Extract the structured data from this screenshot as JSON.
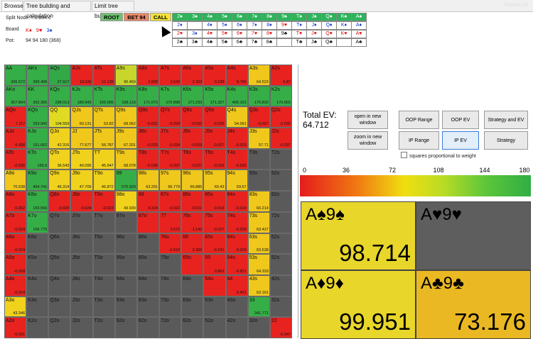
{
  "tabs": [
    "Browser",
    "Tree building and calculation",
    "Limit tree building"
  ],
  "watermark": "Flowsicalr",
  "info": {
    "split_node_label": "Split Node:",
    "split_node_value": "r:0:b94:c",
    "board_label": "Board",
    "board_cards": [
      {
        "t": "K♦",
        "c": "red"
      },
      {
        "t": "9♥",
        "c": "red"
      },
      {
        "t": "3♠",
        "c": "blue"
      }
    ],
    "pot_label": "Pot:",
    "pot_value": "94 94 180 (368)"
  },
  "node_buttons": [
    {
      "label": "ROOT",
      "bg": "#6fc06f"
    },
    {
      "label": "BET 94",
      "bg": "#e88a6a"
    },
    {
      "label": "CALL",
      "bg": "#f2e23a"
    }
  ],
  "card_columns": [
    [
      "2♠",
      "2♦",
      "2♥",
      "2♣"
    ],
    [
      "3♠",
      "",
      "3♦",
      "3♣"
    ],
    [
      "4♠",
      "4♦",
      "4♥",
      "4♣"
    ],
    [
      "5♠",
      "5♦",
      "5♥",
      "5♣"
    ],
    [
      "6♠",
      "6♦",
      "6♥",
      "6♣"
    ],
    [
      "7♠",
      "7♦",
      "7♥",
      "7♣"
    ],
    [
      "8♠",
      "8♦",
      "8♥",
      "8♣"
    ],
    [
      "9♠",
      "9♥",
      "9♣",
      ""
    ],
    [
      "T♠",
      "T♦",
      "T♥",
      "T♣"
    ],
    [
      "J♠",
      "J♦",
      "J♥",
      "J♣"
    ],
    [
      "Q♠",
      "Q♦",
      "Q♥",
      "Q♣"
    ],
    [
      "K♠",
      "K♦",
      "K♥",
      ""
    ],
    [
      "A♠",
      "A♦",
      "A♥",
      "A♣"
    ]
  ],
  "matrix": [
    [
      [
        "AA",
        "336.572",
        "#36ae47"
      ],
      [
        "AKs",
        "369.498",
        "#36ae47"
      ],
      [
        "AQs",
        "27.917",
        "#33a847"
      ],
      [
        "AJs",
        "18.036",
        "#e8221f"
      ],
      [
        "ATs",
        "12.139",
        "#e8221f"
      ],
      [
        "A9s",
        "90.469",
        "#c8d62c"
      ],
      [
        "A8s",
        "2.838",
        "#e8221f"
      ],
      [
        "A7s",
        "2.642",
        "#e8221f"
      ],
      [
        "A6s",
        "2.363",
        "#e8221f"
      ],
      [
        "A5s",
        "9.238",
        "#e8221f"
      ],
      [
        "A4s",
        "8.786",
        "#e8221f"
      ],
      [
        "A3s",
        "64.523",
        "#f0c81c"
      ],
      [
        "A2s",
        "6.87",
        "#e8221f"
      ]
    ],
    [
      [
        "AKo",
        "357.804",
        "#36ae47"
      ],
      [
        "KK",
        "352.356",
        "#36ae47"
      ],
      [
        "KQs",
        "298.013",
        "#36ae47"
      ],
      [
        "KJs",
        "180.943",
        "#36ae47"
      ],
      [
        "KTs",
        "169.005",
        "#36ae47"
      ],
      [
        "K9s",
        "168.119",
        "#36ae47"
      ],
      [
        "K8s",
        "171.073",
        "#36ae47"
      ],
      [
        "K7s",
        "170.898",
        "#36ae47"
      ],
      [
        "K6s",
        "171.233",
        "#36ae47"
      ],
      [
        "K5s",
        "171.327",
        "#36ae47"
      ],
      [
        "K4s",
        "405.101",
        "#36ae47"
      ],
      [
        "K3s",
        "170.832",
        "#36ae47"
      ],
      [
        "K2s",
        "170.903",
        "#36ae47"
      ]
    ],
    [
      [
        "AQo",
        "7.117",
        "#e8221f"
      ],
      [
        "KQo",
        "253.942",
        "#36ae47"
      ],
      [
        "QQ",
        "104.559",
        "#e0da22"
      ],
      [
        "QJs",
        "60.131",
        "#f0c81c"
      ],
      [
        "QTs",
        "53.82",
        "#f0c81c"
      ],
      [
        "Q9s",
        "68.062",
        "#f0c81c"
      ],
      [
        "Q8s",
        "-0.031",
        "#e8221f"
      ],
      [
        "Q7s",
        "-0.034",
        "#e8221f"
      ],
      [
        "Q6s",
        "-0.032",
        "#e8221f"
      ],
      [
        "Q5s",
        "-0.035",
        "#e8221f"
      ],
      [
        "Q4s",
        "54.091",
        "#f0c81c"
      ],
      [
        "Q3s",
        "-0.027",
        "#e8221f"
      ],
      [
        "Q2s",
        "-0.032",
        "#e8221f"
      ]
    ],
    [
      [
        "AJo",
        "6.438",
        "#e8221f"
      ],
      [
        "KJo",
        "151.062",
        "#36ae47"
      ],
      [
        "QJo",
        "42.316",
        "#f0d21c"
      ],
      [
        "JJ",
        "77.677",
        "#f0c81c"
      ],
      [
        "JTs",
        "56.787",
        "#f0c81c"
      ],
      [
        "J9s",
        "67.201",
        "#f0c81c"
      ],
      [
        "J8s",
        "-0.033",
        "#e8221f"
      ],
      [
        "J7s",
        "-0.034",
        "#e8221f"
      ],
      [
        "J6s",
        "-0.026",
        "#e8221f"
      ],
      [
        "J5s",
        "-0.027",
        "#e8221f"
      ],
      [
        "J4s",
        "-0.023",
        "#e8221f"
      ],
      [
        "J3s",
        "57.71",
        "#f0c81c"
      ],
      [
        "J2s",
        "-0.037",
        "#e8221f"
      ]
    ],
    [
      [
        "ATo",
        "-0.036",
        "#e8221f"
      ],
      [
        "KTo",
        "155.6",
        "#36ae47"
      ],
      [
        "QTo",
        "36.543",
        "#f0d21c"
      ],
      [
        "JTo",
        "40.095",
        "#f0d21c"
      ],
      [
        "TT",
        "45.647",
        "#f0d21c"
      ],
      [
        "T9s",
        "68.078",
        "#f0c81c"
      ],
      [
        "T8s",
        "-0.039",
        "#e8221f"
      ],
      [
        "T7s",
        "-0.037",
        "#e8221f"
      ],
      [
        "T6s",
        "-0.027",
        "#e8221f"
      ],
      [
        "T5s",
        "-0.029",
        "#e8221f"
      ],
      [
        "T4s",
        "-0.032",
        "#e8221f"
      ],
      [
        "T3s",
        "",
        "#5a5a5a"
      ],
      [
        "T2s",
        "",
        "#5a5a5a"
      ]
    ],
    [
      [
        "A9o",
        "70.538",
        "#f0c81c"
      ],
      [
        "K9o",
        "454.741",
        "#36ae47"
      ],
      [
        "Q9o",
        "46.314",
        "#f0d21c"
      ],
      [
        "J9o",
        "47.709",
        "#f0d21c"
      ],
      [
        "T9o",
        "46.872",
        "#f0d21c"
      ],
      [
        "99",
        "570.929",
        "#36ae47"
      ],
      [
        "98s",
        "63.291",
        "#f0c81c"
      ],
      [
        "97s",
        "66.779",
        "#f0c81c"
      ],
      [
        "96s",
        "66.885",
        "#f0c81c"
      ],
      [
        "95s",
        "60.43",
        "#f0c81c"
      ],
      [
        "94s",
        "59.57",
        "#f0c81c"
      ],
      [
        "93s",
        "",
        "#5a5a5a"
      ],
      [
        "92s",
        "",
        "#5a5a5a"
      ]
    ],
    [
      [
        "A8o",
        "-0.002",
        "#e8221f"
      ],
      [
        "K8o",
        "153.556",
        "#36ae47"
      ],
      [
        "Q8o",
        "-0.025",
        "#e8221f"
      ],
      [
        "J8o",
        "-0.024",
        "#e8221f"
      ],
      [
        "T8o",
        "-0.023",
        "#e8221f"
      ],
      [
        "98o",
        "43.939",
        "#f0d21c"
      ],
      [
        "88",
        "4.324",
        "#e8221f"
      ],
      [
        "87s",
        "-0.022",
        "#e8221f"
      ],
      [
        "86s",
        "-0.021",
        "#e8221f"
      ],
      [
        "85s",
        "-0.019",
        "#e8221f"
      ],
      [
        "84s",
        "-0.019",
        "#e8221f"
      ],
      [
        "83s",
        "60.214",
        "#f0c81c"
      ],
      [
        "82s",
        "",
        "#5a5a5a"
      ]
    ],
    [
      [
        "A7o",
        "-0.024",
        "#e8221f"
      ],
      [
        "K7o",
        "156.775",
        "#36ae47"
      ],
      [
        "Q7o",
        "",
        "#5a5a5a"
      ],
      [
        "J7o",
        "",
        "#5a5a5a"
      ],
      [
        "T7o",
        "",
        "#5a5a5a"
      ],
      [
        "97o",
        "",
        "#5a5a5a"
      ],
      [
        "87o",
        "",
        "#e8221f"
      ],
      [
        "77",
        "3.672",
        "#e8221f"
      ],
      [
        "76s",
        "-1.142",
        "#e8221f"
      ],
      [
        "75s",
        "-0.027",
        "#e8221f"
      ],
      [
        "74s",
        "-0.029",
        "#e8221f"
      ],
      [
        "73s",
        "63.427",
        "#f0c81c"
      ],
      [
        "72s",
        "",
        "#5a5a5a"
      ]
    ],
    [
      [
        "A6o",
        "-0.024",
        "#e8221f"
      ],
      [
        "K6o",
        "",
        "#5a5a5a"
      ],
      [
        "Q6o",
        "",
        "#5a5a5a"
      ],
      [
        "J6o",
        "",
        "#5a5a5a"
      ],
      [
        "T6o",
        "",
        "#5a5a5a"
      ],
      [
        "96o",
        "",
        "#5a5a5a"
      ],
      [
        "86o",
        "",
        "#5a5a5a"
      ],
      [
        "76o",
        "-0.523",
        "#e8221f"
      ],
      [
        "66",
        "2.369",
        "#e8221f"
      ],
      [
        "65s",
        "-0.241",
        "#e8221f"
      ],
      [
        "64s",
        "-0.029",
        "#e8221f"
      ],
      [
        "63s",
        "63.538",
        "#f0c81c"
      ],
      [
        "62s",
        "",
        "#5a5a5a"
      ]
    ],
    [
      [
        "A5o",
        "-0.028",
        "#e8221f"
      ],
      [
        "K5o",
        "",
        "#5a5a5a"
      ],
      [
        "Q5o",
        "",
        "#5a5a5a"
      ],
      [
        "J5o",
        "",
        "#5a5a5a"
      ],
      [
        "T5o",
        "",
        "#5a5a5a"
      ],
      [
        "95o",
        "",
        "#5a5a5a"
      ],
      [
        "85o",
        "",
        "#5a5a5a"
      ],
      [
        "75o",
        "",
        "#5a5a5a"
      ],
      [
        "65o",
        "",
        "#e8221f"
      ],
      [
        "55",
        "0.863",
        "#e8221f"
      ],
      [
        "54s",
        "-0.821",
        "#e8221f"
      ],
      [
        "53s",
        "64.333",
        "#f0c81c"
      ],
      [
        "52s",
        "",
        "#5a5a5a"
      ]
    ],
    [
      [
        "A4o",
        "-0.024",
        "#e8221f"
      ],
      [
        "K4o",
        "",
        "#5a5a5a"
      ],
      [
        "Q4o",
        "",
        "#5a5a5a"
      ],
      [
        "J4o",
        "",
        "#5a5a5a"
      ],
      [
        "T4o",
        "",
        "#5a5a5a"
      ],
      [
        "94o",
        "",
        "#5a5a5a"
      ],
      [
        "84o",
        "",
        "#5a5a5a"
      ],
      [
        "74o",
        "",
        "#5a5a5a"
      ],
      [
        "64o",
        "",
        "#5a5a5a"
      ],
      [
        "54o",
        "",
        "#e8221f"
      ],
      [
        "44",
        "0.401",
        "#e8221f"
      ],
      [
        "43s",
        "63.161",
        "#f0c81c"
      ],
      [
        "42s",
        "",
        "#5a5a5a"
      ]
    ],
    [
      [
        "A3o",
        "43.346",
        "#f0d21c"
      ],
      [
        "K3o",
        "",
        "#5a5a5a"
      ],
      [
        "Q3o",
        "",
        "#5a5a5a"
      ],
      [
        "J3o",
        "",
        "#5a5a5a"
      ],
      [
        "T3o",
        "",
        "#5a5a5a"
      ],
      [
        "93o",
        "",
        "#5a5a5a"
      ],
      [
        "83o",
        "",
        "#5a5a5a"
      ],
      [
        "73o",
        "",
        "#5a5a5a"
      ],
      [
        "63o",
        "",
        "#5a5a5a"
      ],
      [
        "53o",
        "",
        "#5a5a5a"
      ],
      [
        "43o",
        "",
        "#5a5a5a"
      ],
      [
        "33",
        "341.771",
        "#36ae47"
      ],
      [
        "32s",
        "",
        "#5a5a5a"
      ]
    ],
    [
      [
        "A2o",
        "-0.031",
        "#e8221f"
      ],
      [
        "K2o",
        "",
        "#5a5a5a"
      ],
      [
        "Q2o",
        "",
        "#5a5a5a"
      ],
      [
        "J2o",
        "",
        "#5a5a5a"
      ],
      [
        "T2o",
        "",
        "#5a5a5a"
      ],
      [
        "92o",
        "",
        "#5a5a5a"
      ],
      [
        "82o",
        "",
        "#5a5a5a"
      ],
      [
        "72o",
        "",
        "#5a5a5a"
      ],
      [
        "62o",
        "",
        "#5a5a5a"
      ],
      [
        "52o",
        "",
        "#5a5a5a"
      ],
      [
        "42o",
        "",
        "#5a5a5a"
      ],
      [
        "32o",
        "",
        "#5a5a5a"
      ],
      [
        "22",
        "-0.047",
        "#e8221f"
      ]
    ]
  ],
  "right": {
    "total_ev_label": "Total EV:",
    "total_ev_value": "64.712",
    "buttons": {
      "open": "open in new window",
      "zoom": "zoom in new window",
      "oop_range": "OOP Range",
      "oop_ev": "OOP EV",
      "strat_ev": "Strategy and EV",
      "ip_range": "IP  Range",
      "ip_ev": "IP  EV",
      "strategy": "Strategy"
    },
    "checkbox_label": "squares proportional to weight",
    "scale_ticks": [
      "0",
      "36",
      "72",
      "108",
      "144",
      "180"
    ],
    "combos": [
      {
        "hand": "A♠9♠",
        "ev": "98.714",
        "bg": "#e8d62a"
      },
      {
        "hand": "A♥9♥",
        "ev": "",
        "bg": "#5e5e5e"
      },
      {
        "hand": "A♦9♦",
        "ev": "99.951",
        "bg": "#e8d62a"
      },
      {
        "hand": "A♣9♣",
        "ev": "73.176",
        "bg": "#eab822"
      }
    ]
  }
}
